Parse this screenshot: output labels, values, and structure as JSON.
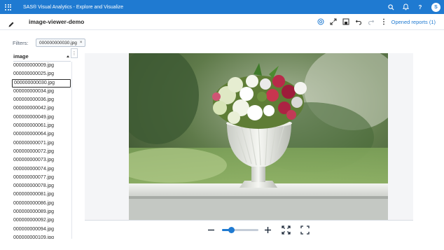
{
  "app": {
    "title": "SAS® Visual Analytics - Explore and Visualize",
    "user_initial": "S"
  },
  "colors": {
    "brand": "#1f7ad1",
    "text": "#2b2b2b"
  },
  "top_icons": [
    "apps-grid-icon",
    "search-icon",
    "bell-icon",
    "help-icon",
    "avatar"
  ],
  "top_icon_glyphs": {
    "help": "?"
  },
  "report": {
    "title": "image-viewer-demo",
    "opened_reports": "Opened reports (1)",
    "tools": [
      "info-icon",
      "expand-icon",
      "save-icon",
      "undo-icon",
      "redo-icon",
      "more-icon"
    ]
  },
  "filters": {
    "label": "Filters:",
    "chip": "000000000030.jpg",
    "chip_close": "×"
  },
  "list": {
    "header": "image",
    "menu": "⋮",
    "selected_index": 2,
    "items": [
      "000000000009.jpg",
      "000000000025.jpg",
      "000000000030.jpg",
      "000000000034.jpg",
      "000000000036.jpg",
      "000000000042.jpg",
      "000000000049.jpg",
      "000000000061.jpg",
      "000000000064.jpg",
      "000000000071.jpg",
      "000000000072.jpg",
      "000000000073.jpg",
      "000000000074.jpg",
      "000000000077.jpg",
      "000000000078.jpg",
      "000000000081.jpg",
      "000000000086.jpg",
      "000000000089.jpg",
      "000000000092.jpg",
      "000000000094.jpg",
      "000000000109.jpg"
    ]
  },
  "viewer": {
    "image_subject": "white vase with flower bouquet on a white railing",
    "zoom_level": 0.25,
    "controls": [
      "zoom-out-icon",
      "zoom-slider",
      "zoom-in-icon",
      "fit-icon",
      "fullscreen-icon"
    ]
  }
}
